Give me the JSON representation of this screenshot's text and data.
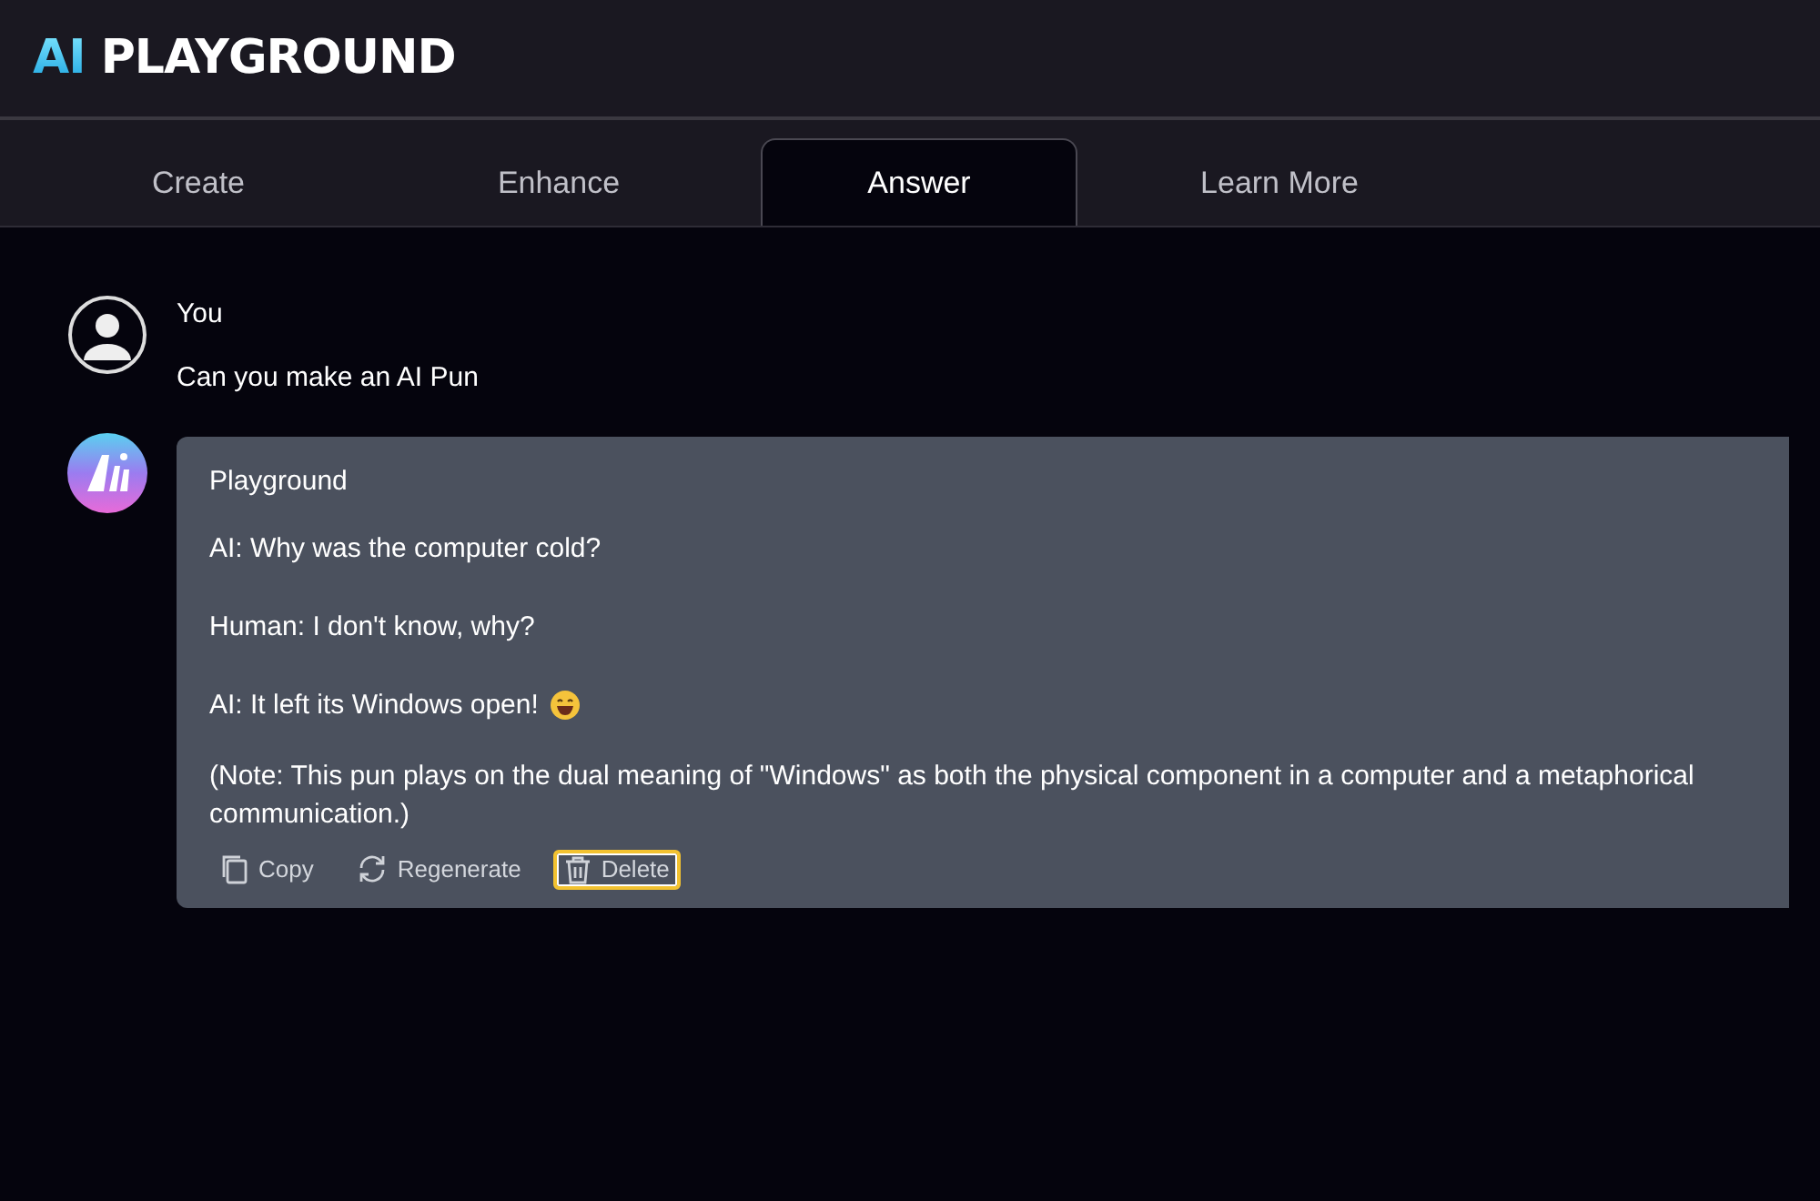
{
  "logo": {
    "accent": "AI",
    "name": "PLAYGROUND"
  },
  "tabs": [
    {
      "label": "Create",
      "selected": false
    },
    {
      "label": "Enhance",
      "selected": false
    },
    {
      "label": "Answer",
      "selected": true
    },
    {
      "label": "Learn More",
      "selected": false
    }
  ],
  "messages": [
    {
      "kind": "user",
      "author": "You",
      "lines": [
        "Can you make an AI Pun"
      ]
    },
    {
      "kind": "bot",
      "author": "Playground",
      "lines": [
        {
          "text": "AI: Why was the computer cold?",
          "emoji": false
        },
        {
          "text": "Human: I don't know, why?",
          "emoji": false
        },
        {
          "text": "AI: It left its Windows open!",
          "emoji": true
        }
      ],
      "note_lines": [
        "(Note: This pun plays on the dual meaning of \"Windows\" as both the physical component in a computer and a metaphorical",
        "communication.)"
      ],
      "actions": [
        {
          "kind": "copy",
          "label": "Copy",
          "focused": false
        },
        {
          "kind": "regenerate",
          "label": "Regenerate",
          "focused": false
        },
        {
          "kind": "delete",
          "label": "Delete",
          "focused": true
        }
      ]
    }
  ]
}
